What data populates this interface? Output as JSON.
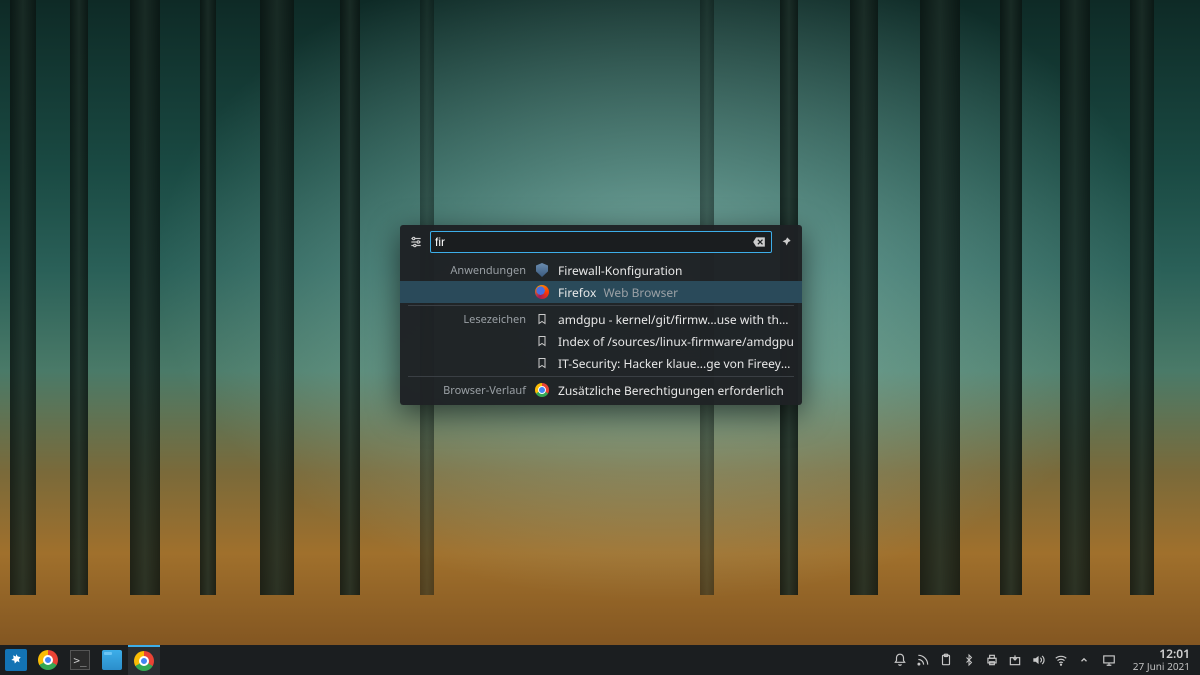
{
  "krunner": {
    "query": "fir",
    "categories": {
      "apps": "Anwendungen",
      "bookmarks": "Lesezeichen",
      "history": "Browser-Verlauf"
    },
    "results": {
      "app_firewall": "Firewall-Konfiguration",
      "app_firefox": "Firefox",
      "app_firefox_sub": "Web Browser",
      "bm_amdgpu": "amdgpu - kernel/git/firmw...use with the Linux kernel",
      "bm_index": "Index of /sources/linux-firmware/amdgpu",
      "bm_golem": "IT-Security: Hacker klaue...ge von Fireeye - Golem.de",
      "hist_perm": "Zusätzliche Berechtigungen erforderlich"
    }
  },
  "panel": {
    "clock_time": "12:01",
    "clock_date": "27 Juni 2021"
  }
}
